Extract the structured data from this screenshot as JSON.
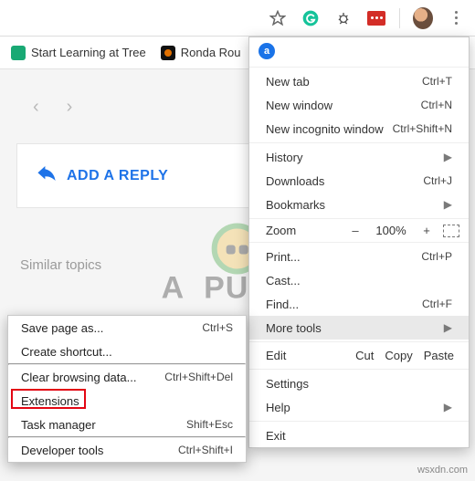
{
  "toolbar": {
    "star_icon": "star",
    "grammarly_icon": "g-circle",
    "bug_icon": "bug",
    "lastpass_icon": "dots"
  },
  "bookmarks": {
    "items": [
      {
        "label": "Start Learning at Tree"
      },
      {
        "label": "Ronda Rou"
      }
    ]
  },
  "page": {
    "add_reply_label": "ADD A REPLY",
    "similar_topics_label": "Similar topics"
  },
  "menu": {
    "new_tab": {
      "label": "New tab",
      "kbd": "Ctrl+T"
    },
    "new_window": {
      "label": "New window",
      "kbd": "Ctrl+N"
    },
    "incognito": {
      "label": "New incognito window",
      "kbd": "Ctrl+Shift+N"
    },
    "history": {
      "label": "History"
    },
    "downloads": {
      "label": "Downloads",
      "kbd": "Ctrl+J"
    },
    "bookmarks": {
      "label": "Bookmarks"
    },
    "zoom": {
      "label": "Zoom",
      "minus": "–",
      "pct": "100%",
      "plus": "+"
    },
    "print": {
      "label": "Print...",
      "kbd": "Ctrl+P"
    },
    "cast": {
      "label": "Cast..."
    },
    "find": {
      "label": "Find...",
      "kbd": "Ctrl+F"
    },
    "more_tools": {
      "label": "More tools"
    },
    "edit": {
      "label": "Edit",
      "cut": "Cut",
      "copy": "Copy",
      "paste": "Paste"
    },
    "settings": {
      "label": "Settings"
    },
    "help": {
      "label": "Help"
    },
    "exit": {
      "label": "Exit"
    }
  },
  "submenu": {
    "save_page": {
      "label": "Save page as...",
      "kbd": "Ctrl+S"
    },
    "create_shortcut": {
      "label": "Create shortcut..."
    },
    "clear_data": {
      "label": "Clear browsing data...",
      "kbd": "Ctrl+Shift+Del"
    },
    "extensions": {
      "label": "Extensions"
    },
    "task_manager": {
      "label": "Task manager",
      "kbd": "Shift+Esc"
    },
    "dev_tools": {
      "label": "Developer tools",
      "kbd": "Ctrl+Shift+I"
    }
  },
  "watermark": {
    "brand_before": "A",
    "brand_after": "PUALS"
  },
  "credit": "wsxdn.com"
}
